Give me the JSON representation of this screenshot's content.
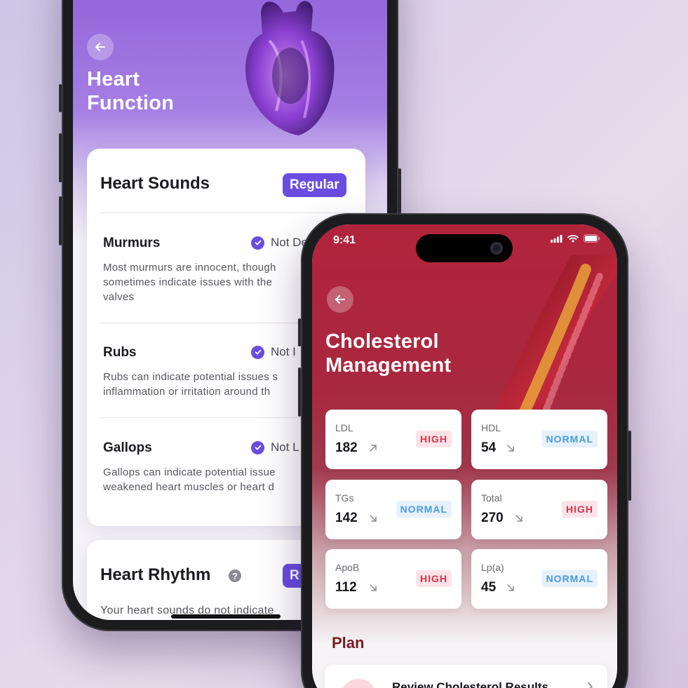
{
  "heart_app": {
    "title_line1": "Heart",
    "title_line2": "Function",
    "sounds": {
      "title": "Heart Sounds",
      "badge": "Regular",
      "items": [
        {
          "title": "Murmurs",
          "status": "Not De",
          "desc1": "Most murmurs are innocent, though",
          "desc2": "sometimes indicate issues with the",
          "desc3": "valves"
        },
        {
          "title": "Rubs",
          "status": "Not I",
          "desc1": "Rubs can indicate potential issues s",
          "desc2": "inflammation or irritation around th"
        },
        {
          "title": "Gallops",
          "status": "Not L",
          "desc1": "Gallops can indicate potential issue",
          "desc2": "weakened heart muscles or heart d"
        }
      ]
    },
    "rhythm": {
      "title": "Heart Rhythm",
      "help": "?",
      "badge": "R",
      "desc": "Your heart sounds do not indicate"
    }
  },
  "cholesterol_app": {
    "status_time": "9:41",
    "title_line1": "Cholesterol",
    "title_line2": "Management",
    "metrics": [
      {
        "label": "LDL",
        "value": "182",
        "trend": "up",
        "status": "HIGH"
      },
      {
        "label": "HDL",
        "value": "54",
        "trend": "down",
        "status": "NORMAL"
      },
      {
        "label": "TGs",
        "value": "142",
        "trend": "down",
        "status": "NORMAL"
      },
      {
        "label": "Total",
        "value": "270",
        "trend": "down",
        "status": "HIGH"
      },
      {
        "label": "ApoB",
        "value": "112",
        "trend": "down",
        "status": "HIGH"
      },
      {
        "label": "Lp(a)",
        "value": "45",
        "trend": "down",
        "status": "NORMAL"
      }
    ],
    "plan": {
      "heading": "Plan",
      "item_title": "Review Cholesterol Results"
    }
  },
  "colors": {
    "heart_accent": "#6a4de0",
    "cholesterol_accent": "#b2233c",
    "high": "#d6354f",
    "normal": "#4a9be0"
  }
}
